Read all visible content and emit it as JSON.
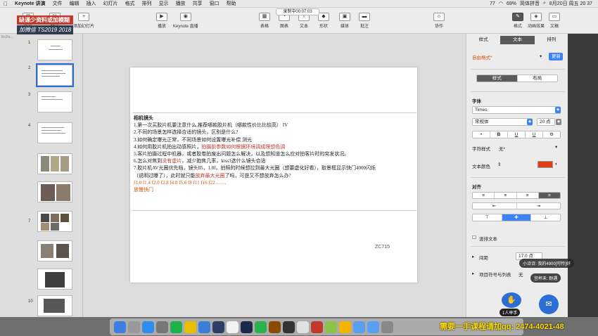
{
  "menubar": {
    "app": "Keynote 讲演",
    "items": [
      "文件",
      "编辑",
      "插入",
      "幻灯片",
      "格式",
      "排列",
      "显示",
      "播放",
      "共享",
      "窗口",
      "帮助"
    ],
    "status": {
      "badge": "77",
      "battery": "69%",
      "input": "简体拼音",
      "datetime": "8月20日 周五 20 37"
    }
  },
  "recording": "录制中00:07:03",
  "watermark": {
    "line1": "缺课少资料或加模糊",
    "line2": "加微信 TS2019 2018"
  },
  "toolbar": {
    "left": [
      {
        "label": "显示",
        "icon": "▤"
      },
      {
        "label": "缩放",
        "icon": "%"
      },
      {
        "label": "添加幻灯片",
        "icon": "+"
      }
    ],
    "mid": [
      {
        "label": "播放",
        "icon": "▶"
      },
      {
        "label": "Keynote 直播",
        "icon": "◉"
      }
    ],
    "insert": [
      {
        "label": "表格",
        "icon": "▦"
      },
      {
        "label": "图表",
        "icon": "◔"
      },
      {
        "label": "文本",
        "icon": "T"
      },
      {
        "label": "形状",
        "icon": "◆"
      },
      {
        "label": "媒体",
        "icon": "▣"
      },
      {
        "label": "批注",
        "icon": "▬"
      }
    ],
    "collab": {
      "label": "协作",
      "icon": "☺"
    },
    "right": [
      {
        "label": "格式",
        "icon": "✎"
      },
      {
        "label": "动画效果",
        "icon": "◈"
      },
      {
        "label": "文稿",
        "icon": "▭"
      }
    ]
  },
  "corner_label": "8c0fa...",
  "slide_numbers": [
    "1",
    "2",
    "3",
    "4",
    "5",
    "6",
    "7",
    "8",
    "9",
    "10"
  ],
  "slide": {
    "title": "相机镜头",
    "lines": [
      {
        "text": "1.第一次买胶片机要注意什么,推荐哪款胶片机（哪款性价比比较高）",
        "tail": "IV",
        "cls": ""
      },
      {
        "text": "2.不同的场景怎样选择合适的镜头，区别是什么?",
        "cls": ""
      },
      {
        "text": "3.如何确定曝光正常，不同场景如何设置曝光补偿  测光",
        "cls": ""
      },
      {
        "text": "4.如何用胶片机拍出动感照片，",
        "red": "拍摄前参数如何根据环境调成理想色调",
        "cls": ""
      },
      {
        "text": "5.客片拍摄过程中机器，或者胶卷拍废出问题怎么解决，以及想知道怎么应对拍客片时的突发状况。",
        "cls": ""
      },
      {
        "text": "6.怎么对焦到",
        "red": "没有虚片",
        "after": "，减少跑焦几率，kiss3选什么镜头合适",
        "cls": ""
      },
      {
        "text": "7.胶片机AV光圈优先档，镜头85，1.8f，拍照的时候想拉到最大光圈（想要虚化好看），取景框显示快门4000闪烁",
        "cls": ""
      },
      {
        "text": "（说明过曝了），此时就只能",
        "red": "放弃最大光圈",
        "after": "了吗，可是又不想放弃怎么办?",
        "cls": ""
      },
      {
        "text": "f1.0   f1.4   f2.0   f2.8   f4.0   f5.6   f8   f11  f16  f22  ……",
        "cls": "orange"
      },
      {
        "text": "放慢快门",
        "cls": "orange"
      }
    ],
    "caption": "ZC715"
  },
  "inspector": {
    "tabs": [
      "样式",
      "文本",
      "排列"
    ],
    "paragraph_style": "自由格式*",
    "update_button": "更新",
    "seg_style": [
      "样式",
      "布局"
    ],
    "font_heading": "字体",
    "font_name": "Times",
    "font_weight": "常规体",
    "font_size": "20 点",
    "format_buttons": [
      "•",
      "B",
      "U",
      "U",
      "⚙"
    ],
    "char_style_label": "字符样式",
    "char_style_value": "无*",
    "text_color_label": "文本颜色",
    "text_color": "#e03e12",
    "align_heading": "对齐",
    "vertical_text": "竖排文本",
    "spacing_label": "间距",
    "spacing_value": "17.0 点",
    "bullets_label": "项目符号与列表",
    "bullets_value": "无"
  },
  "overlays": {
    "chat1": "小诗诗: 我的4900[可怜]好",
    "chat2": "宫杯禾: 耐遇",
    "raise_hand": "1人举手"
  },
  "promo": "需要一手课程请加qq: 2474-4021-48"
}
